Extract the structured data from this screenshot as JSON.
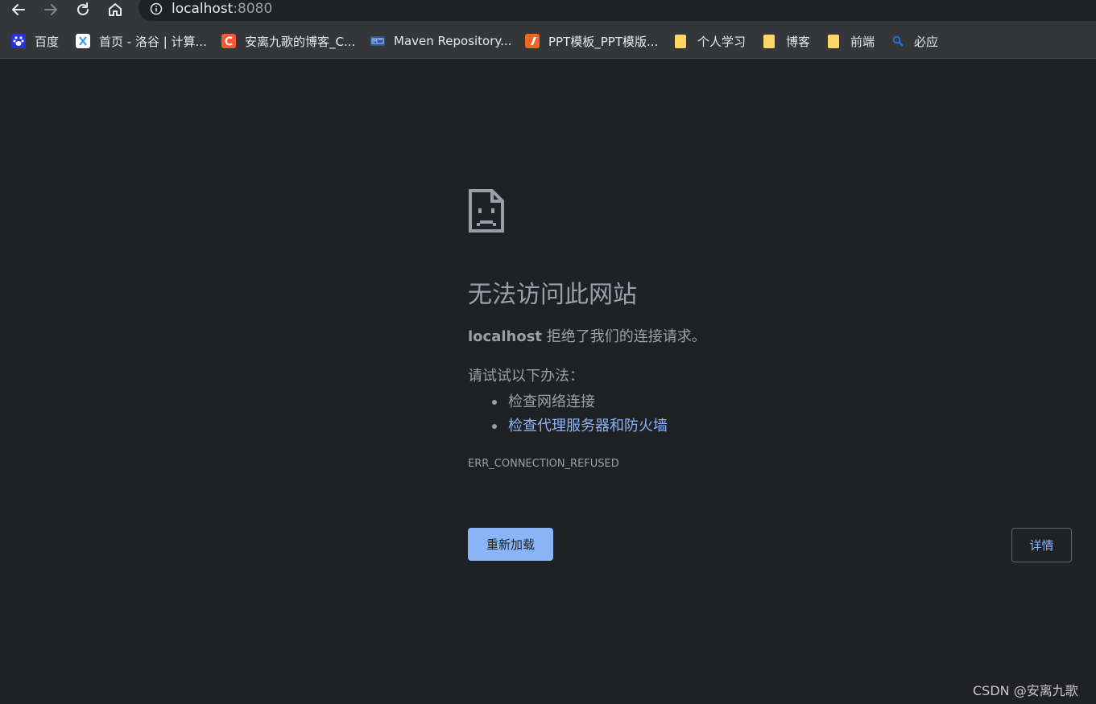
{
  "browser": {
    "url_host": "localhost",
    "url_port": ":8080",
    "back_icon": "arrow-left-icon",
    "forward_icon": "arrow-right-icon",
    "reload_icon": "reload-icon",
    "home_icon": "home-icon",
    "info_icon": "info-circle-icon"
  },
  "bookmarks": [
    {
      "label": "百度",
      "icon": "baidu-paw-icon",
      "color": "#2932e1"
    },
    {
      "label": "首页 - 洛谷 | 计算...",
      "icon": "luogu-icon",
      "color": "#ffffff"
    },
    {
      "label": "安离九歌的博客_C...",
      "icon": "csdn-icon",
      "color": "#fc5531"
    },
    {
      "label": "Maven Repository...",
      "icon": "maven-icon",
      "color": "#2b5797"
    },
    {
      "label": "PPT模板_PPT模版...",
      "icon": "ppt-icon",
      "color": "#f26522"
    },
    {
      "label": "个人学习",
      "icon": "folder-icon",
      "color": "#fdd663"
    },
    {
      "label": "博客",
      "icon": "folder-icon",
      "color": "#fdd663"
    },
    {
      "label": "前端",
      "icon": "folder-icon",
      "color": "#fdd663"
    },
    {
      "label": "必应",
      "icon": "bing-search-icon",
      "color": "#1a73e8"
    }
  ],
  "error": {
    "icon": "sad-page-icon",
    "title": "无法访问此网站",
    "host": "localhost",
    "message": " 拒绝了我们的连接请求。",
    "try_label": "请试试以下办法：",
    "suggestions": [
      "检查网络连接",
      "检查代理服务器和防火墙"
    ],
    "code": "ERR_CONNECTION_REFUSED",
    "reload_label": "重新加载",
    "details_label": "详情"
  },
  "watermark": "CSDN @安离九歌",
  "colors": {
    "background": "#202124",
    "toolbar": "#35363a",
    "text": "#9aa0a6",
    "link": "#8ab4f8",
    "button": "#8ab4f8"
  }
}
